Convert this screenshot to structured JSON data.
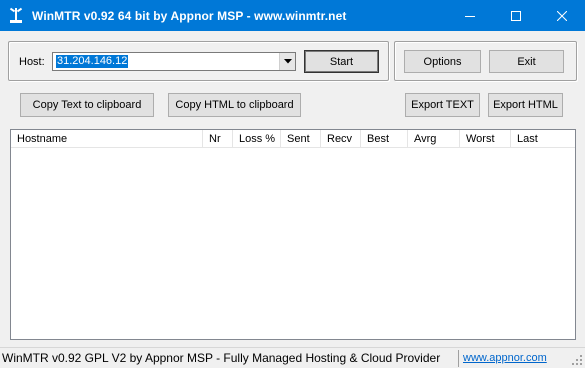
{
  "window": {
    "title": "WinMTR v0.92 64 bit by Appnor MSP - www.winmtr.net",
    "icon": "antenna-icon"
  },
  "host": {
    "label": "Host:",
    "value": "31.204.146.12"
  },
  "buttons": {
    "start": "Start",
    "options": "Options",
    "exit": "Exit",
    "copy_text": "Copy Text to clipboard",
    "copy_html": "Copy HTML to clipboard",
    "export_text": "Export TEXT",
    "export_html": "Export HTML"
  },
  "table": {
    "columns": [
      "Hostname",
      "Nr",
      "Loss %",
      "Sent",
      "Recv",
      "Best",
      "Avrg",
      "Worst",
      "Last"
    ],
    "rows": []
  },
  "status": {
    "text": "WinMTR v0.92 GPL V2 by Appnor MSP - Fully Managed Hosting & Cloud Provider",
    "link": "www.appnor.com"
  },
  "colors": {
    "titlebar": "#0078d7",
    "selection": "#0078d7",
    "link": "#0066cc"
  }
}
